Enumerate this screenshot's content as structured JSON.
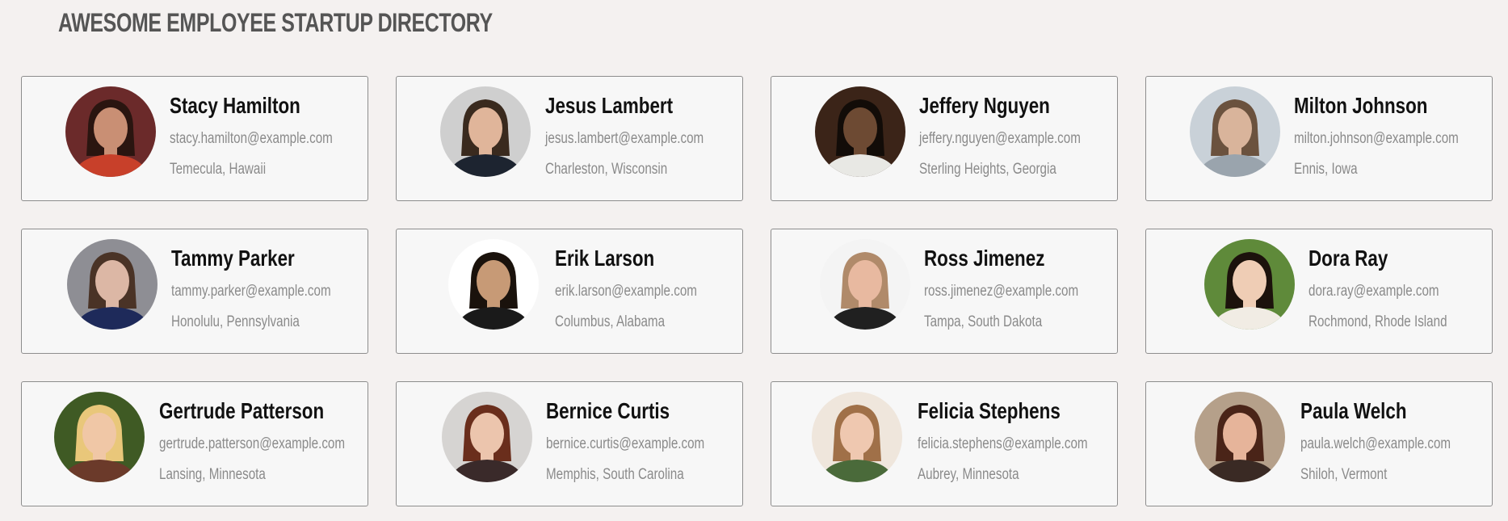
{
  "page": {
    "title": "AWESOME EMPLOYEE STARTUP DIRECTORY"
  },
  "employees": [
    {
      "name": "Stacy Hamilton",
      "email": "stacy.hamilton@example.com",
      "location": "Temecula, Hawaii",
      "bg": "#6b2a2a",
      "skin": "#c98f74",
      "hair": "#2a1510",
      "shirt": "#c8402a"
    },
    {
      "name": "Jesus Lambert",
      "email": "jesus.lambert@example.com",
      "location": "Charleston, Wisconsin",
      "bg": "#cfcfcf",
      "skin": "#e0b59a",
      "hair": "#3a2a1e",
      "shirt": "#1d2430"
    },
    {
      "name": "Jeffery Nguyen",
      "email": "jeffery.nguyen@example.com",
      "location": "Sterling Heights, Georgia",
      "bg": "#3b2418",
      "skin": "#6d4a33",
      "hair": "#120c08",
      "shirt": "#e8e8e4"
    },
    {
      "name": "Milton Johnson",
      "email": "milton.johnson@example.com",
      "location": "Ennis, Iowa",
      "bg": "#c9d1d8",
      "skin": "#d9b49b",
      "hair": "#6b523e",
      "shirt": "#9aa4ad"
    },
    {
      "name": "Tammy Parker",
      "email": "tammy.parker@example.com",
      "location": "Honolulu, Pennsylvania",
      "bg": "#8e8e94",
      "skin": "#dcb7a5",
      "hair": "#4a3326",
      "shirt": "#1e2a5a"
    },
    {
      "name": "Erik Larson",
      "email": "erik.larson@example.com",
      "location": "Columbus, Alabama",
      "bg": "#ffffff",
      "skin": "#c79a76",
      "hair": "#1a120c",
      "shirt": "#1a1a1a"
    },
    {
      "name": "Ross Jimenez",
      "email": "ross.jimenez@example.com",
      "location": "Tampa, South Dakota",
      "bg": "#f4f4f4",
      "skin": "#e8b9a0",
      "hair": "#b08a6a",
      "shirt": "#202020"
    },
    {
      "name": "Dora Ray",
      "email": "dora.ray@example.com",
      "location": "Rochmond, Rhode Island",
      "bg": "#5f8a3a",
      "skin": "#efcdb5",
      "hair": "#1c120c",
      "shirt": "#f1ece4"
    },
    {
      "name": "Gertrude Patterson",
      "email": "gertrude.patterson@example.com",
      "location": "Lansing, Minnesota",
      "bg": "#3f5a24",
      "skin": "#f0c7a6",
      "hair": "#e9c77a",
      "shirt": "#6b3a2a"
    },
    {
      "name": "Bernice Curtis",
      "email": "bernice.curtis@example.com",
      "location": "Memphis, South Carolina",
      "bg": "#d6d4d2",
      "skin": "#ecc5ad",
      "hair": "#6a2e1c",
      "shirt": "#3a2a2a"
    },
    {
      "name": "Felicia Stephens",
      "email": "felicia.stephens@example.com",
      "location": "Aubrey, Minnesota",
      "bg": "#efe6dc",
      "skin": "#efc8b0",
      "hair": "#a07048",
      "shirt": "#4a6a3a"
    },
    {
      "name": "Paula Welch",
      "email": "paula.welch@example.com",
      "location": "Shiloh, Vermont",
      "bg": "#b5a08a",
      "skin": "#e6b49a",
      "hair": "#4a2418",
      "shirt": "#3a2a24"
    }
  ]
}
